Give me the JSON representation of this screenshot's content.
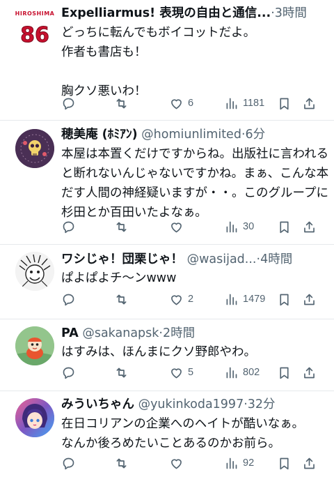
{
  "tweets": [
    {
      "name": "Expelliarmus! 表現の自由と通信...",
      "handle": "",
      "dot": "·",
      "time": "3時間",
      "text": "どっちに転んでもボイコットだよ。\n作者も書店も！\n\n胸クソ悪いわ！",
      "likes": "6",
      "views": "1181",
      "avatar": {
        "type": "jersey",
        "team": "HIROSHIMA",
        "number": "86",
        "color": "#c8102e"
      }
    },
    {
      "name": "穂美庵 (ﾎﾐｱﾝ)",
      "handle": "@homiunlimited",
      "dot": "·",
      "time": "6分",
      "text": "本屋は本置くだけですからね。出版社に言われると断れないんじゃないですかね。まぁ、こんな本だす人間の神経疑いますが・・。このグループに杉田とか百田いたよなぁ。",
      "likes": "",
      "views": "30",
      "avatar": {
        "type": "skull",
        "color": "#5b3a5e"
      }
    },
    {
      "name": "ワシじゃ！団栗じゃ！",
      "handle": "@wasijad...",
      "dot": "·",
      "time": "4時間",
      "text": "ぱよぱよチ〜ンwww",
      "likes": "2",
      "views": "1479",
      "avatar": {
        "type": "manga",
        "color": "#e9e9e9"
      }
    },
    {
      "name": "PA",
      "handle": "@sakanapsk",
      "dot": "·",
      "time": "2時間",
      "text": "はすみは、ほんまにクソ野郎やわ。",
      "likes": "5",
      "views": "802",
      "avatar": {
        "type": "fish",
        "color": "#8fc28a"
      }
    },
    {
      "name": "みういちゃん",
      "handle": "@yukinkoda1997",
      "dot": "·",
      "time": "32分",
      "text": "在日コリアンの企業へのヘイトが酷いなぁ。\nなんか後ろめたいことあるのかお前ら。",
      "likes": "",
      "views": "92",
      "avatar": {
        "type": "anime",
        "color": "#6a5acd"
      }
    }
  ],
  "icons": [
    "reply-icon",
    "retweet-icon",
    "like-icon",
    "views-icon",
    "bookmark-icon",
    "share-icon"
  ]
}
